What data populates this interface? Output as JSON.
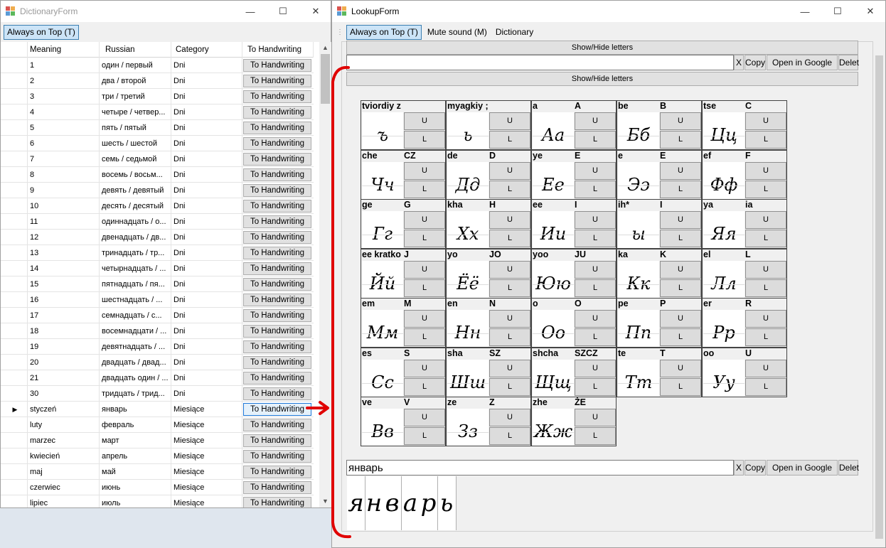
{
  "dict": {
    "title": "DictionaryForm",
    "toolbar_always": "Always on Top (T)",
    "columns": [
      "Meaning",
      "Russian",
      "Category",
      "To Handwriting"
    ],
    "rows": [
      {
        "m": "1",
        "r": "один / первый",
        "c": "Dni",
        "b": "To Handwriting"
      },
      {
        "m": "2",
        "r": "два / второй",
        "c": "Dni",
        "b": "To Handwriting"
      },
      {
        "m": "3",
        "r": "три / третий",
        "c": "Dni",
        "b": "To Handwriting"
      },
      {
        "m": "4",
        "r": "четыре / четвер...",
        "c": "Dni",
        "b": "To Handwriting"
      },
      {
        "m": "5",
        "r": "пять / пятый",
        "c": "Dni",
        "b": "To Handwriting"
      },
      {
        "m": "6",
        "r": "шесть / шестой",
        "c": "Dni",
        "b": "To Handwriting"
      },
      {
        "m": "7",
        "r": "семь / седьмой",
        "c": "Dni",
        "b": "To Handwriting"
      },
      {
        "m": "8",
        "r": "восемь / восьм...",
        "c": "Dni",
        "b": "To Handwriting"
      },
      {
        "m": "9",
        "r": "девять / девятый",
        "c": "Dni",
        "b": "To Handwriting"
      },
      {
        "m": "10",
        "r": "десять / десятый",
        "c": "Dni",
        "b": "To Handwriting"
      },
      {
        "m": "11",
        "r": "одиннадцать / о...",
        "c": "Dni",
        "b": "To Handwriting"
      },
      {
        "m": "12",
        "r": "двенадцать / дв...",
        "c": "Dni",
        "b": "To Handwriting"
      },
      {
        "m": "13",
        "r": "тринадцать / тр...",
        "c": "Dni",
        "b": "To Handwriting"
      },
      {
        "m": "14",
        "r": "четырнадцать / ...",
        "c": "Dni",
        "b": "To Handwriting"
      },
      {
        "m": "15",
        "r": "пятнадцать / пя...",
        "c": "Dni",
        "b": "To Handwriting"
      },
      {
        "m": "16",
        "r": "шестнадцать / ...",
        "c": "Dni",
        "b": "To Handwriting"
      },
      {
        "m": "17",
        "r": "семнадцать / с...",
        "c": "Dni",
        "b": "To Handwriting"
      },
      {
        "m": "18",
        "r": "восемнадцати / ...",
        "c": "Dni",
        "b": "To Handwriting"
      },
      {
        "m": "19",
        "r": "девятнадцать / ...",
        "c": "Dni",
        "b": "To Handwriting"
      },
      {
        "m": "20",
        "r": "двадцать / двад...",
        "c": "Dni",
        "b": "To Handwriting"
      },
      {
        "m": "21",
        "r": "двадцать один / ...",
        "c": "Dni",
        "b": "To Handwriting"
      },
      {
        "m": "30",
        "r": "тридцать / трид...",
        "c": "Dni",
        "b": "To Handwriting"
      },
      {
        "m": "styczeń",
        "r": "январь",
        "c": "Miesiące",
        "b": "To Handwriting"
      },
      {
        "m": "luty",
        "r": "февраль",
        "c": "Miesiące",
        "b": "To Handwriting"
      },
      {
        "m": "marzec",
        "r": "март",
        "c": "Miesiące",
        "b": "To Handwriting"
      },
      {
        "m": "kwiecień",
        "r": "апрель",
        "c": "Miesiące",
        "b": "To Handwriting"
      },
      {
        "m": "maj",
        "r": "май",
        "c": "Miesiące",
        "b": "To Handwriting"
      },
      {
        "m": "czerwiec",
        "r": "июнь",
        "c": "Miesiące",
        "b": "To Handwriting"
      },
      {
        "m": "lipiec",
        "r": "июль",
        "c": "Miesiące",
        "b": "To Handwriting"
      }
    ]
  },
  "lookup": {
    "title": "LookupForm",
    "menu": [
      "Always on Top (T)",
      "Mute sound (M)",
      "Dictionary"
    ],
    "show_hide": "Show/Hide letters",
    "btn_x": "X",
    "btn_copy": "Copy",
    "btn_google": "Open in Google",
    "btn_delete": "Delet",
    "input1": "",
    "input2": "январь",
    "upper_label": "U",
    "lower_label": "L",
    "letters": [
      {
        "n": "tviordiy z",
        "l": "",
        "g": "ъ"
      },
      {
        "n": "myagkiy ;",
        "l": "",
        "g": "ь"
      },
      {
        "n": "a",
        "l": "A",
        "g": "Аа"
      },
      {
        "n": "be",
        "l": "B",
        "g": "Бб"
      },
      {
        "n": "tse",
        "l": "C",
        "g": "Цц"
      },
      {
        "n": "che",
        "l": "CZ",
        "g": "Чч"
      },
      {
        "n": "de",
        "l": "D",
        "g": "Дд"
      },
      {
        "n": "ye",
        "l": "E",
        "g": "Ее"
      },
      {
        "n": "e",
        "l": "E",
        "g": "Ээ"
      },
      {
        "n": "ef",
        "l": "F",
        "g": "Фф"
      },
      {
        "n": "ge",
        "l": "G",
        "g": "Гг"
      },
      {
        "n": "kha",
        "l": "H",
        "g": "Хх"
      },
      {
        "n": "ee",
        "l": "I",
        "g": "Ии"
      },
      {
        "n": "ih*",
        "l": "I",
        "g": "ы"
      },
      {
        "n": "ya",
        "l": "ia",
        "g": "Яя"
      },
      {
        "n": "ee kratko",
        "l": "J",
        "g": "Йй"
      },
      {
        "n": "yo",
        "l": "JO",
        "g": "Ёё"
      },
      {
        "n": "yoo",
        "l": "JU",
        "g": "Юю"
      },
      {
        "n": "ka",
        "l": "K",
        "g": "Кк"
      },
      {
        "n": "el",
        "l": "L",
        "g": "Лл"
      },
      {
        "n": "em",
        "l": "M",
        "g": "Мм"
      },
      {
        "n": "en",
        "l": "N",
        "g": "Нн"
      },
      {
        "n": "o",
        "l": "O",
        "g": "Оо"
      },
      {
        "n": "pe",
        "l": "P",
        "g": "Пп"
      },
      {
        "n": "er",
        "l": "R",
        "g": "Рр"
      },
      {
        "n": "es",
        "l": "S",
        "g": "Сс"
      },
      {
        "n": "sha",
        "l": "SZ",
        "g": "Шш"
      },
      {
        "n": "shcha",
        "l": "SZCZ",
        "g": "Щщ"
      },
      {
        "n": "te",
        "l": "T",
        "g": "Тт"
      },
      {
        "n": "oo",
        "l": "U",
        "g": "Уу"
      },
      {
        "n": "ve",
        "l": "V",
        "g": "Вв"
      },
      {
        "n": "ze",
        "l": "Z",
        "g": "Зз"
      },
      {
        "n": "zhe",
        "l": "ŻE",
        "g": "Жж"
      }
    ],
    "handwriting": [
      "я",
      "н",
      "в",
      "а",
      "р",
      "ь"
    ]
  },
  "accent_arrow": "#e00000"
}
